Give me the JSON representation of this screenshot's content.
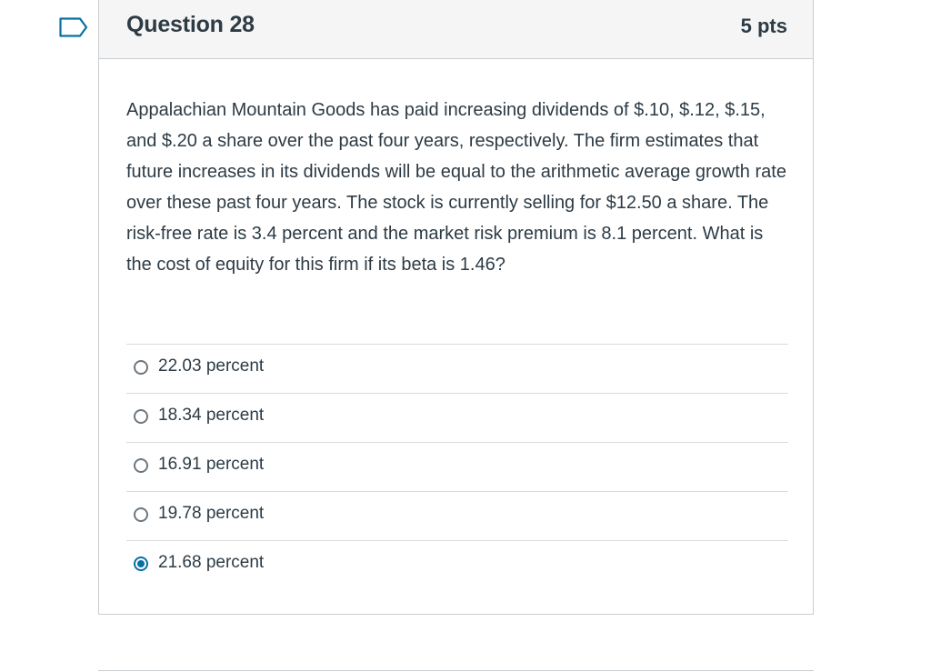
{
  "question": {
    "title": "Question 28",
    "points": "5 pts",
    "text": "Appalachian Mountain Goods has paid increasing dividends of $.10, $.12, $.15, and $.20 a share over the past four years, respectively. The firm estimates that future increases in its dividends will be equal to the arithmetic average growth rate over these past four years. The stock is currently selling for $12.50 a share. The risk-free rate is 3.4 percent and the market risk premium is 8.1 percent. What is the cost of equity for this firm if its beta is 1.46?"
  },
  "answers": [
    {
      "label": "22.03 percent",
      "selected": false
    },
    {
      "label": "18.34 percent",
      "selected": false
    },
    {
      "label": "16.91 percent",
      "selected": false
    },
    {
      "label": "19.78 percent",
      "selected": false
    },
    {
      "label": "21.68 percent",
      "selected": true
    }
  ],
  "icons": {
    "flag": "bookmark-flag-icon"
  },
  "colors": {
    "accent": "#0770a3",
    "border": "#c7cdd1",
    "header_bg": "#f5f5f5",
    "text": "#2d3b45"
  }
}
